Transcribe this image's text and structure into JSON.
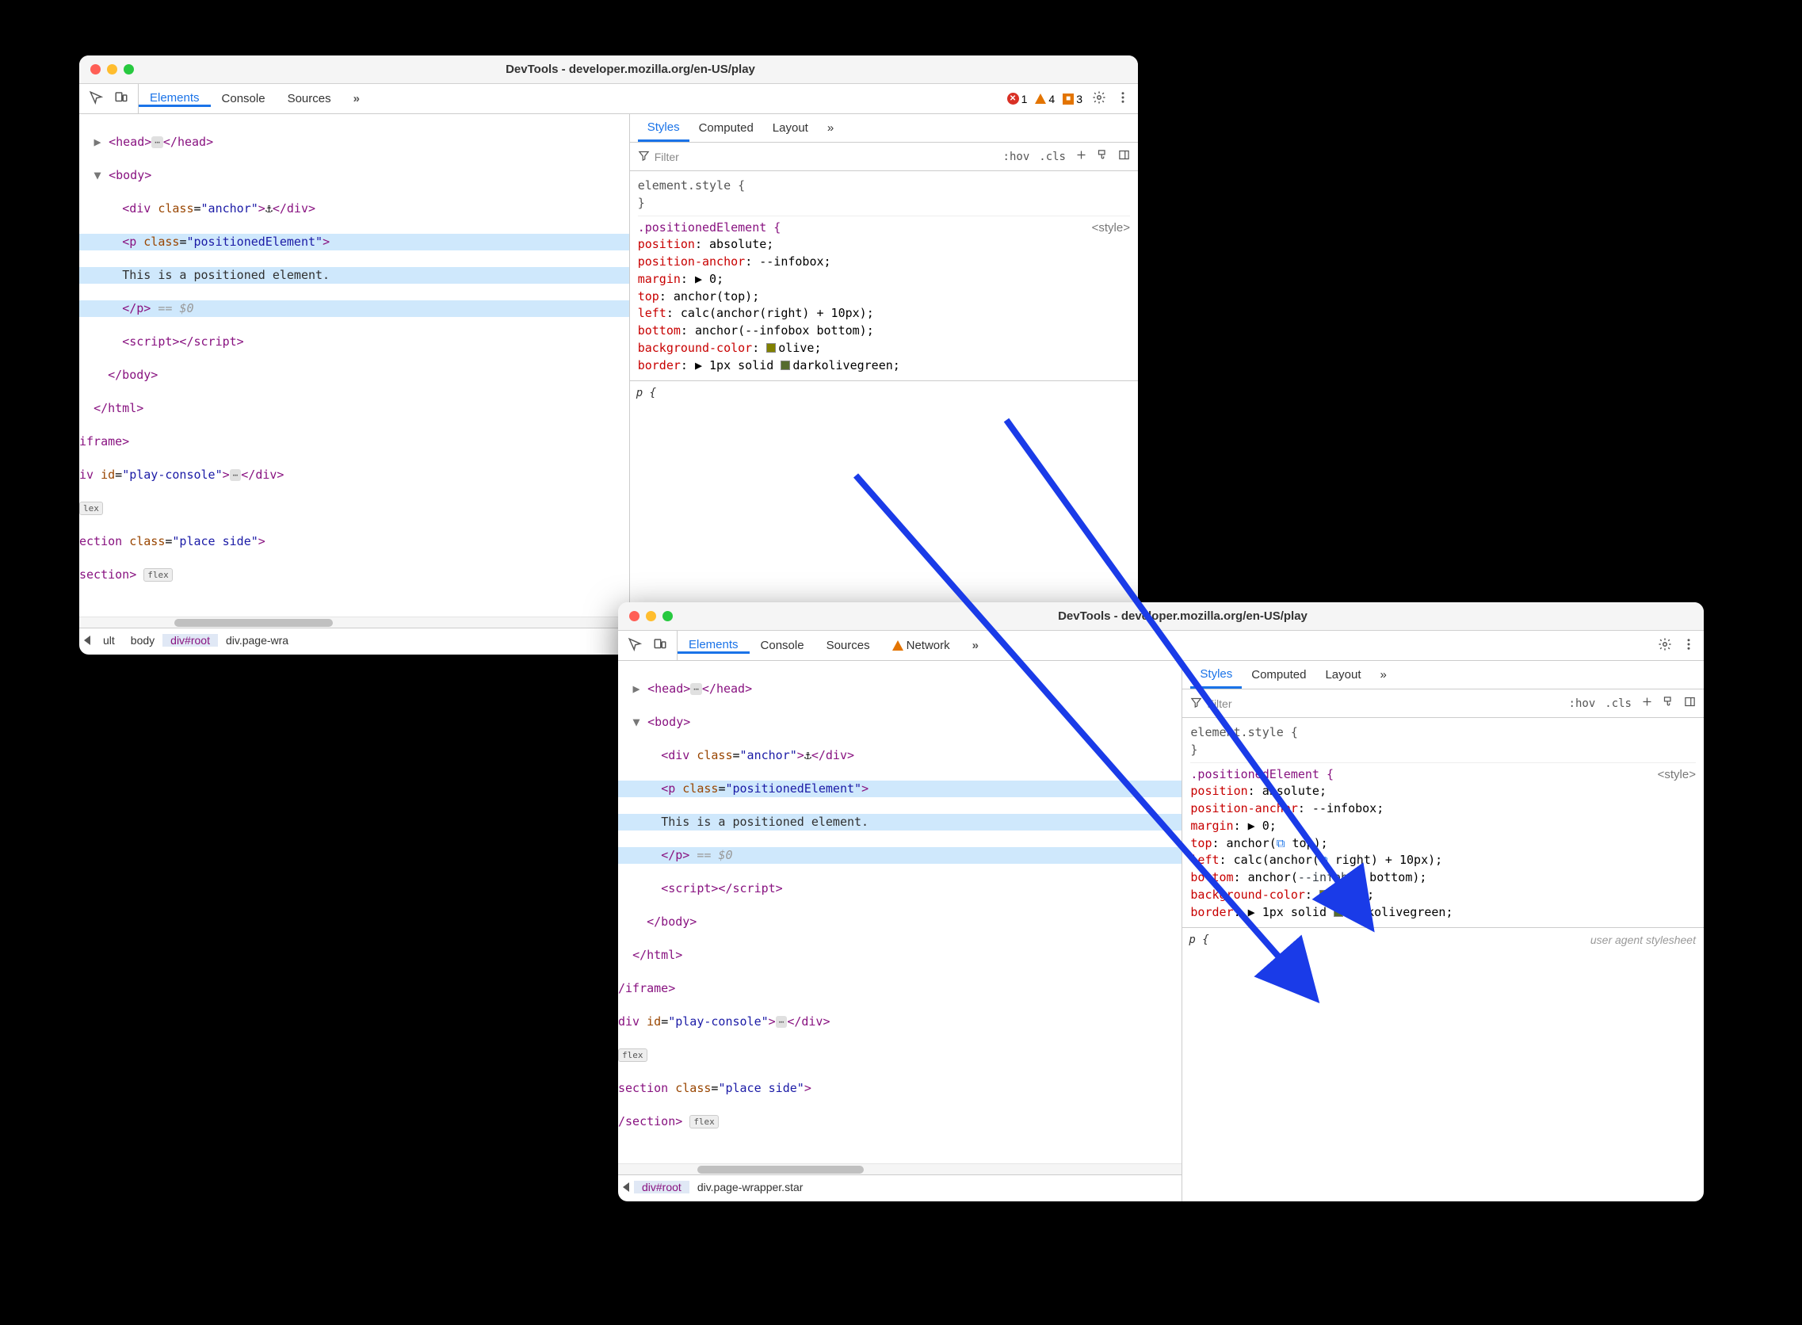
{
  "window1": {
    "title": "DevTools - developer.mozilla.org/en-US/play",
    "tabs": {
      "elements": "Elements",
      "console": "Console",
      "sources": "Sources"
    },
    "counters": {
      "errors": "1",
      "warnings": "4",
      "issues": "3"
    },
    "stylesTabs": {
      "styles": "Styles",
      "computed": "Computed",
      "layout": "Layout"
    },
    "filter": {
      "placeholder": "Filter",
      "hov": ":hov",
      "cls": ".cls"
    },
    "dom": {
      "head_open": "<head>",
      "head_close": "</head>",
      "body_open": "<body>",
      "div_anchor": "<div class=\"anchor\">⚓</div>",
      "p_open": "<p class=\"positionedElement\">",
      "p_text": "This is a positioned element.",
      "p_close": "</p>",
      "eq": " == ",
      "dollar": "$0",
      "script": "<script></script>",
      "body_close": "</body>",
      "html_close": "</html>",
      "iframe_close": "iframe>",
      "div_play": "iv id=\"play-console\">",
      "div_play_close": "</div>",
      "flex": "lex",
      "section": "ection class=\"place side\">",
      "section_close": "section>",
      "flex2": "flex"
    },
    "styles": {
      "elstyle": "element.style {",
      "close": "}",
      "selector": ".positionedElement {",
      "link": "<style>",
      "p_position": {
        "k": "position",
        "v": "absolute"
      },
      "p_posanchor": {
        "k": "position-anchor",
        "v": "--infobox"
      },
      "p_margin": {
        "k": "margin",
        "v": "▶ 0"
      },
      "p_top": {
        "k": "top",
        "v": "anchor(top)"
      },
      "p_left": {
        "k": "left",
        "v": "calc(anchor(right) + 10px)"
      },
      "p_bottom": {
        "k": "bottom",
        "v": "anchor(--infobox bottom)"
      },
      "p_bg": {
        "k": "background-color",
        "v": "olive"
      },
      "p_border": {
        "k": "border",
        "v": "▶ 1px solid ",
        "v2": "darkolivegreen"
      },
      "p_rule": "p {"
    },
    "crumbs": {
      "c1": "ult",
      "c2": "body",
      "c3": "div#root",
      "c4": "div.page-wra"
    }
  },
  "window2": {
    "title": "DevTools - developer.mozilla.org/en-US/play",
    "tabs": {
      "elements": "Elements",
      "console": "Console",
      "sources": "Sources",
      "network": "Network"
    },
    "stylesTabs": {
      "styles": "Styles",
      "computed": "Computed",
      "layout": "Layout"
    },
    "filter": {
      "placeholder": "Filter",
      "hov": ":hov",
      "cls": ".cls"
    },
    "dom": {
      "head_open": "<head>",
      "head_close": "</head>",
      "body_open": "<body>",
      "div_anchor": "<div class=\"anchor\">⚓</div>",
      "p_open": "<p class=\"positionedElement\">",
      "p_text": "This is a positioned element.",
      "p_close": "</p>",
      "eq": " == ",
      "dollar": "$0",
      "script": "<script></script>",
      "body_close": "</body>",
      "html_close": "</html>",
      "iframe_close": "/iframe>",
      "div_play": "div id=\"play-console\">",
      "div_play_close": "</div>",
      "flex": "flex",
      "section": "section class=\"place side\">",
      "section_close": "/section>",
      "flex2": "flex"
    },
    "styles": {
      "elstyle": "element.style {",
      "close": "}",
      "selector": ".positionedElement {",
      "link": "<style>",
      "p_position": {
        "k": "position",
        "v": "absolute"
      },
      "p_posanchor": {
        "k": "position-anchor",
        "v": "--infobox"
      },
      "p_margin": {
        "k": "margin",
        "v": "▶ 0"
      },
      "p_top": {
        "k": "top",
        "v_pre": "anchor(",
        "v_post": " top)"
      },
      "p_left": {
        "k": "left",
        "v_pre": "calc(anchor(",
        "v_post": " right) + 10px)"
      },
      "p_bottom": {
        "k": "bottom",
        "v": "anchor(",
        "v_var": "--infobox",
        "v2": " bottom)"
      },
      "p_bg": {
        "k": "background-color",
        "v": "olive"
      },
      "p_border": {
        "k": "border",
        "v": "▶ 1px solid ",
        "v2": "darkolivegreen"
      },
      "p_rule": "p {",
      "ua": "user agent stylesheet"
    },
    "crumbs": {
      "c1": "div#root",
      "c2": "div.page-wrapper.star"
    }
  }
}
